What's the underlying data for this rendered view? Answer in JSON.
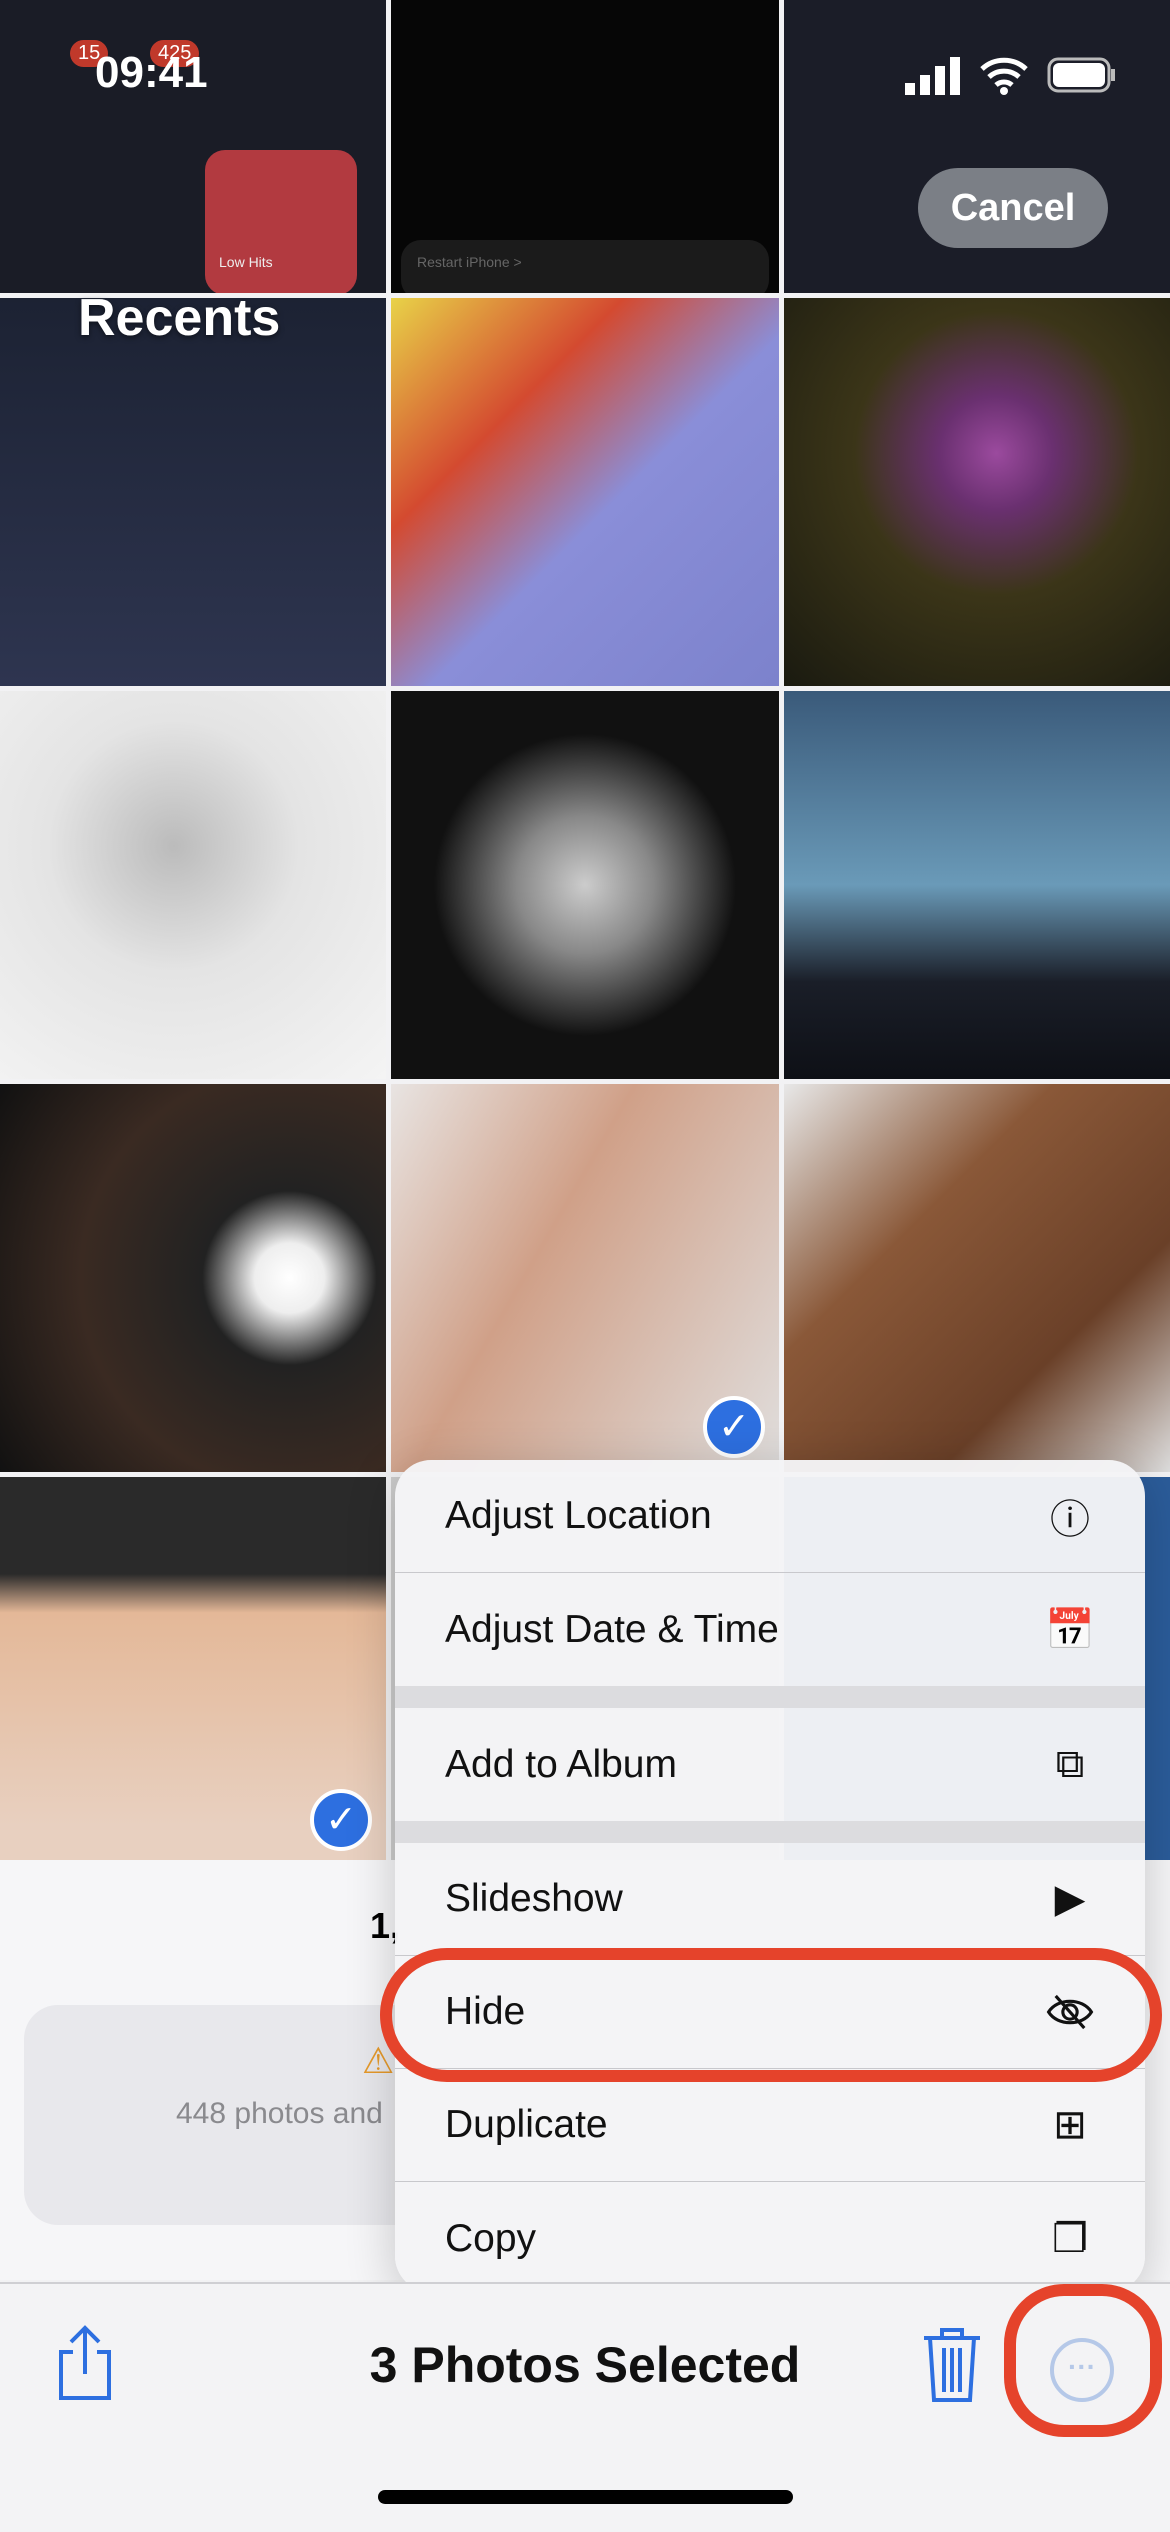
{
  "status_bar": {
    "time": "09:41"
  },
  "header": {
    "title": "Recents",
    "cancel_label": "Cancel"
  },
  "thumb_texts": {
    "restart": "Restart iPhone >",
    "low_hits": "Low Hits",
    "badge1": "15",
    "badge2": "425"
  },
  "library": {
    "count_partial": "1,",
    "warning_partial": "448 photos and"
  },
  "menu": {
    "items": [
      {
        "label": "Adjust Location",
        "icon": "location-pin-icon"
      },
      {
        "label": "Adjust Date & Time",
        "icon": "calendar-clock-icon"
      },
      {
        "label": "Add to Album",
        "icon": "add-album-icon"
      },
      {
        "label": "Slideshow",
        "icon": "play-icon"
      },
      {
        "label": "Hide",
        "icon": "eye-slash-icon"
      },
      {
        "label": "Duplicate",
        "icon": "duplicate-icon"
      },
      {
        "label": "Copy",
        "icon": "copy-icon"
      }
    ]
  },
  "toolbar": {
    "title": "3 Photos Selected"
  },
  "colors": {
    "accent": "#2d6fe0",
    "highlight": "#e5432b"
  }
}
